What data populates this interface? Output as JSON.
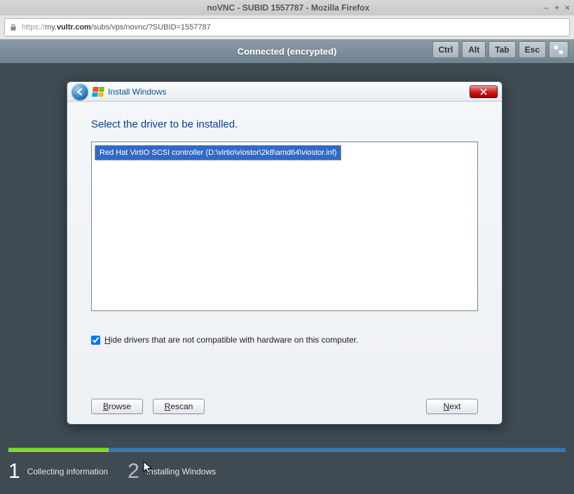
{
  "host": {
    "title": "noVNC - SUBID 1557787 - Mozilla Firefox",
    "url_proto": "https://",
    "url_pre": "my.",
    "url_host": "vultr.com",
    "url_rest": "/subs/vps/novnc/?SUBID=1557787",
    "win_min": "–",
    "win_max": "+",
    "win_close": "×"
  },
  "vnc": {
    "status": "Connected (encrypted)",
    "keys": {
      "ctrl": "Ctrl",
      "alt": "Alt",
      "tab": "Tab",
      "esc": "Esc"
    }
  },
  "dialog": {
    "title": "Install Windows",
    "heading": "Select the driver to be installed.",
    "driver_selected": "Red Hat VirtIO SCSI controller (D:\\virtio\\viostor\\2k8\\amd64\\viostor.inf)",
    "hide_label_first": "H",
    "hide_label_rest": "ide drivers that are not compatible with hardware on this computer.",
    "hide_checked": true,
    "buttons": {
      "browse_u": "B",
      "browse_rest": "rowse",
      "rescan_u": "R",
      "rescan_rest": "escan",
      "next_u": "N",
      "next_rest": "ext"
    }
  },
  "footer": {
    "step1_num": "1",
    "step1_label": "Collecting information",
    "step2_num": "2",
    "step2_label": "Installing Windows"
  }
}
